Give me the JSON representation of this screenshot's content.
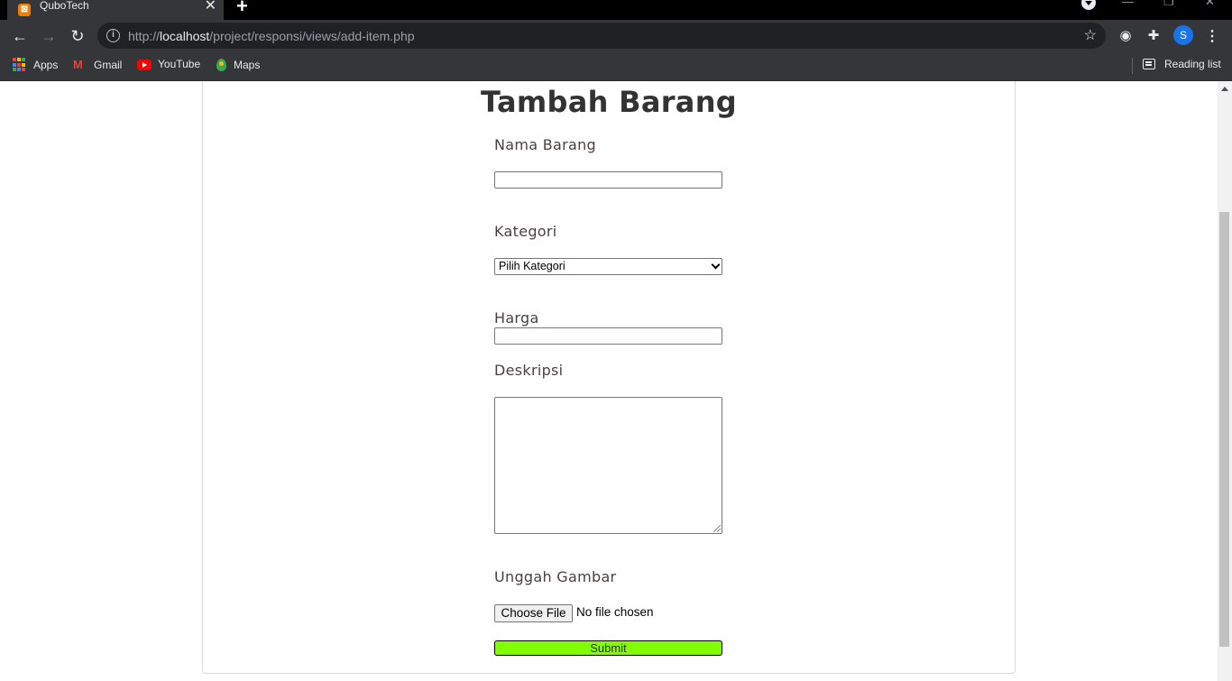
{
  "browser": {
    "tab_title": "QuboTech",
    "url_prefix": "http://",
    "url_host": "localhost",
    "url_path": "/project/responsi/views/add-item.php",
    "profile_initial": "S"
  },
  "bookmarks": {
    "items": [
      {
        "label": "Apps",
        "icon": "apps-grid-icon"
      },
      {
        "label": "Gmail",
        "icon": "gmail-icon"
      },
      {
        "label": "YouTube",
        "icon": "youtube-icon"
      },
      {
        "label": "Maps",
        "icon": "maps-icon"
      }
    ],
    "reading_list": "Reading list"
  },
  "form": {
    "title": "Tambah Barang",
    "nama_label": "Nama Barang",
    "nama_value": "",
    "kategori_label": "Kategori",
    "kategori_selected": "Pilih Kategori",
    "harga_label": "Harga",
    "harga_value": "",
    "deskripsi_label": "Deskripsi",
    "deskripsi_value": "",
    "gambar_label": "Unggah Gambar",
    "file_button": "Choose File",
    "file_status": "No file chosen",
    "submit_label": "Submit"
  },
  "colors": {
    "submit_bg": "#80ff00",
    "chrome_bg": "#35363a",
    "omnibox_bg": "#202124"
  }
}
